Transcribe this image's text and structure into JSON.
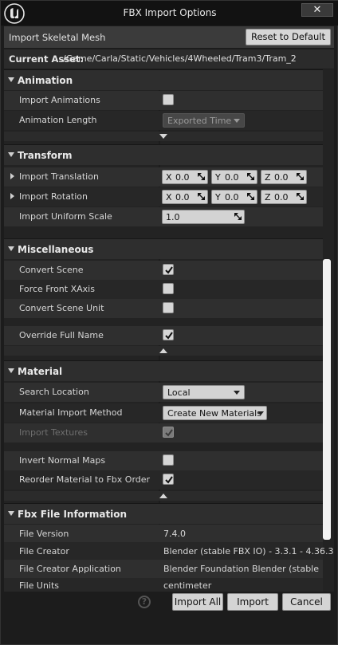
{
  "window": {
    "title": "FBX Import Options",
    "close_glyph": "✕"
  },
  "header": {
    "import_type": "Import Skeletal Mesh",
    "reset_button": "Reset to Default",
    "current_asset_label": "Current Asset:",
    "current_asset_path": "/Game/Carla/Static/Vehicles/4Wheeled/Tram3/Tram_2"
  },
  "animation": {
    "title": "Animation",
    "import_animations_label": "Import Animations",
    "import_animations_checked": false,
    "animation_length_label": "Animation Length",
    "animation_length_value": "Exported Time"
  },
  "transform": {
    "title": "Transform",
    "import_translation_label": "Import Translation",
    "import_translation": {
      "x_label": "X",
      "x": "0.0",
      "y_label": "Y",
      "y": "0.0",
      "z_label": "Z",
      "z": "0.0"
    },
    "import_rotation_label": "Import Rotation",
    "import_rotation": {
      "x_label": "X",
      "x": "0.0",
      "y_label": "Y",
      "y": "0.0",
      "z_label": "Z",
      "z": "0.0"
    },
    "import_uniform_scale_label": "Import Uniform Scale",
    "import_uniform_scale": "1.0"
  },
  "misc": {
    "title": "Miscellaneous",
    "convert_scene_label": "Convert Scene",
    "convert_scene_checked": true,
    "force_front_xaxis_label": "Force Front XAxis",
    "force_front_xaxis_checked": false,
    "convert_scene_unit_label": "Convert Scene Unit",
    "convert_scene_unit_checked": false,
    "override_full_name_label": "Override Full Name",
    "override_full_name_checked": true
  },
  "material": {
    "title": "Material",
    "search_location_label": "Search Location",
    "search_location_value": "Local",
    "material_import_method_label": "Material Import Method",
    "material_import_method_value": "Create New Materials",
    "import_textures_label": "Import Textures",
    "import_textures_checked": true,
    "invert_normal_maps_label": "Invert Normal Maps",
    "invert_normal_maps_checked": false,
    "reorder_material_label": "Reorder Material to Fbx Order",
    "reorder_material_checked": true
  },
  "fbx_info": {
    "title": "Fbx File Information",
    "file_version_label": "File Version",
    "file_version": "7.4.0",
    "file_creator_label": "File Creator",
    "file_creator": "Blender (stable FBX IO) - 3.3.1 - 4.36.3",
    "file_creator_app_label": "File Creator Application",
    "file_creator_app": "Blender Foundation Blender (stable FBX",
    "file_units_label": "File Units",
    "file_units": "centimeter"
  },
  "footer": {
    "help_glyph": "?",
    "import_all": "Import All",
    "import": "Import",
    "cancel": "Cancel"
  }
}
